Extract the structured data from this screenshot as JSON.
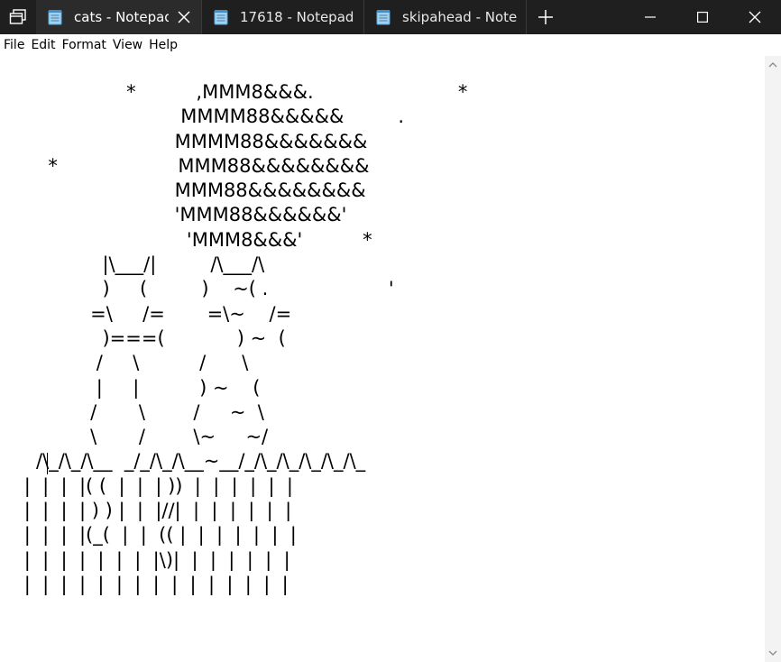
{
  "tabs": [
    {
      "title": "cats - Notepad",
      "active": true
    },
    {
      "title": "17618 - Notepad",
      "active": false
    },
    {
      "title": "skipahead - Notepad",
      "active": false
    }
  ],
  "menu": [
    "File",
    "Edit",
    "Format",
    "View",
    "Help"
  ],
  "editor": {
    "text": "                     *          ,MMM8&&&.                        *\n                              MMMM88&&&&&         .\n                             MMMM88&&&&&&&\n        *                    MMM88&&&&&&&&\n                             MMM88&&&&&&&&\n                             'MMM88&&&&&&'\n                               'MMM8&&&'          *\n                 |\\___/|         /\\___/\\\n                 )     (         )    ~( .                    '\n               =\\     /=       =\\~    /=\n                 )===(            ) ~  (\n                /     \\          /      \\\n                |     |          ) ~    (\n               /       \\        /     ~  \\\n               \\       /        \\~     ~/\n      /\\_/\\_/\\__  _/_/\\_/\\__~__/_/\\_/\\_/\\_/\\_/\\_\n    |  |  |  |( (  |  |  | ))  |  |  |  |  |  |\n    |  |  |  | ) ) |  |  |//|  |  |  |  |  |  |\n    |  |  |  |(_(  |  |  (( |  |  |  |  |  |  |\n    |  |  |  |  |  |  |  |\\)|  |  |  |  |  |  |\n    |  |  |  |  |  |  |  |  |  |  |  |  |  |  |"
  },
  "colors": {
    "titlebar": "#1f1f1f",
    "active_tab": "#2b2b2b",
    "text": "#000000",
    "background": "#ffffff"
  },
  "icons": {
    "taskview": "taskview-icon",
    "notepad": "notepad-icon",
    "close_tab": "close-icon",
    "new_tab": "plus-icon",
    "minimize": "minimize-icon",
    "maximize": "maximize-icon",
    "close_window": "close-icon"
  }
}
